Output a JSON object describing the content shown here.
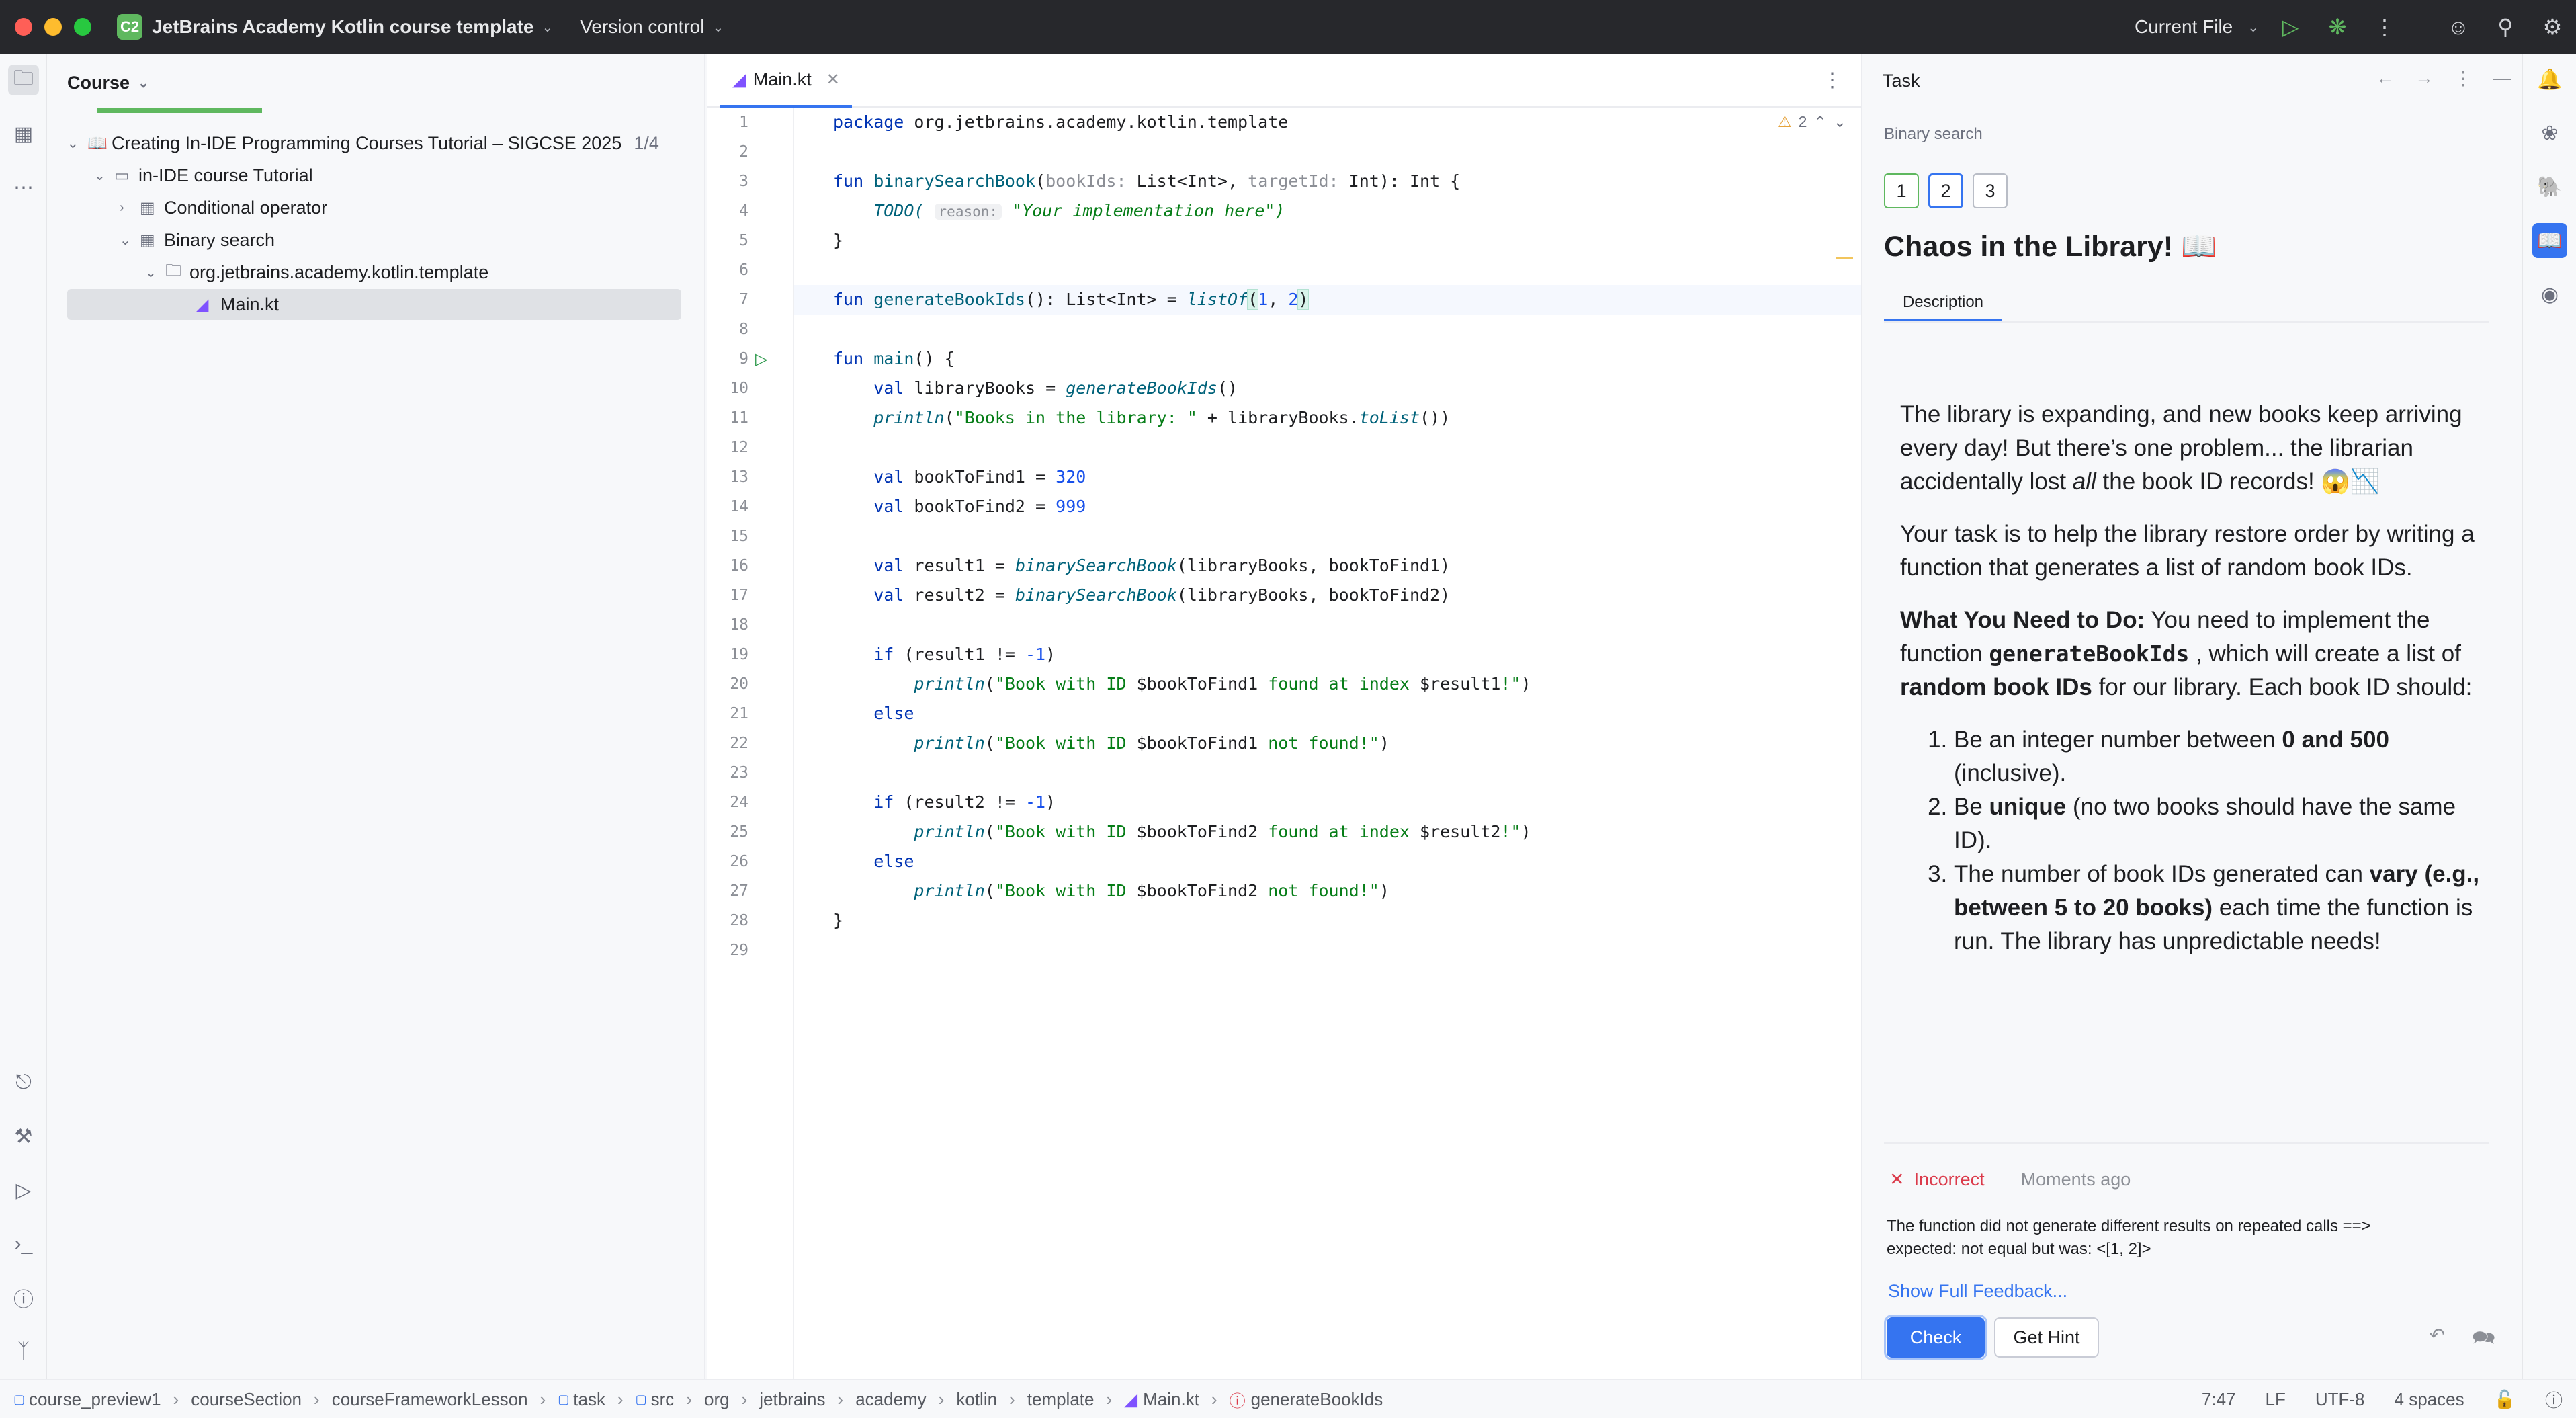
{
  "titlebar": {
    "project_badge": "C2",
    "project_name": "JetBrains Academy Kotlin course template",
    "vcs": "Version control",
    "run_config": "Current File",
    "colors": {
      "close": "#ff5f57",
      "minimize": "#febc2e",
      "zoom": "#28c840"
    }
  },
  "project_panel": {
    "header": "Course",
    "tree": [
      {
        "label": "Creating In-IDE Programming Courses Tutorial – SIGCSE 2025",
        "extra": "1/4"
      },
      {
        "label": "in-IDE course Tutorial"
      },
      {
        "label": "Conditional operator"
      },
      {
        "label": "Binary search"
      },
      {
        "label": "org.jetbrains.academy.kotlin.template"
      },
      {
        "label": "Main.kt"
      }
    ]
  },
  "editor": {
    "tab_label": "Main.kt",
    "warning_count": "2",
    "line_numbers": [
      "1",
      "2",
      "3",
      "4",
      "5",
      "6",
      "7",
      "8",
      "9",
      "10",
      "11",
      "12",
      "13",
      "14",
      "15",
      "16",
      "17",
      "18",
      "19",
      "20",
      "21",
      "22",
      "23",
      "24",
      "25",
      "26",
      "27",
      "28",
      "29"
    ],
    "hints": {
      "bookIds": "bookIds:",
      "targetId": "targetId:",
      "reason": "reason:"
    },
    "lines": {
      "l1_kw": "package",
      "l1_rest": " org.jetbrains.academy.kotlin.template",
      "l3_kw": "fun",
      "l3_fn": " binarySearchBook",
      "l3_a": "(",
      "l3_b": " List<Int>, ",
      "l3_c": " Int): Int {",
      "l4_todo": "    TODO(",
      "l4_str": " \"Your implementation here\")",
      "l5": "}",
      "l7_kw": "fun",
      "l7_fn": " generateBookIds",
      "l7_a": "(): List<Int> = ",
      "l7_call": "listOf",
      "l7_open": "(",
      "l7_n1": "1",
      "l7_comma": ", ",
      "l7_n2": "2",
      "l7_close": ")",
      "l9_kw": "fun",
      "l9_fn": " main",
      "l9_rest": "() {",
      "l10_kw": "    val",
      "l10_a": " libraryBooks = ",
      "l10_call": "generateBookIds",
      "l10_b": "()",
      "l11_call": "    println",
      "l11_a": "(",
      "l11_str": "\"Books in the library: \"",
      "l11_b": " + libraryBooks.",
      "l11_call2": "toList",
      "l11_c": "())",
      "l13_kw": "    val",
      "l13_a": " bookToFind1 = ",
      "l13_num": "320",
      "l14_kw": "    val",
      "l14_a": " bookToFind2 = ",
      "l14_num": "999",
      "l16_kw": "    val",
      "l16_a": " result1 = ",
      "l16_call": "binarySearchBook",
      "l16_b": "(libraryBooks, bookToFind1)",
      "l17_kw": "    val",
      "l17_a": " result2 = ",
      "l17_call": "binarySearchBook",
      "l17_b": "(libraryBooks, bookToFind2)",
      "l19_kw": "    if",
      "l19_a": " (result1 != ",
      "l19_num": "-1",
      "l19_b": ")",
      "l20_call": "        println",
      "l20_a": "(",
      "l20_s1": "\"Book with ID ",
      "l20_v1": "$bookToFind1",
      "l20_s2": " found at index ",
      "l20_v2": "$result1",
      "l20_s3": "!\"",
      "l20_b": ")",
      "l21_kw": "    else",
      "l22_call": "        println",
      "l22_a": "(",
      "l22_s1": "\"Book with ID ",
      "l22_v1": "$bookToFind1",
      "l22_s2": " not found!\"",
      "l22_b": ")",
      "l24_kw": "    if",
      "l24_a": " (result2 != ",
      "l24_num": "-1",
      "l24_b": ")",
      "l25_call": "        println",
      "l25_a": "(",
      "l25_s1": "\"Book with ID ",
      "l25_v1": "$bookToFind2",
      "l25_s2": " found at index ",
      "l25_v2": "$result2",
      "l25_s3": "!\"",
      "l25_b": ")",
      "l26_kw": "    else",
      "l27_call": "        println",
      "l27_a": "(",
      "l27_s1": "\"Book with ID ",
      "l27_v1": "$bookToFind2",
      "l27_s2": " not found!\"",
      "l27_b": ")",
      "l28": "}"
    }
  },
  "task_panel": {
    "header": "Task",
    "lesson": "Binary search",
    "steps": [
      "1",
      "2",
      "3"
    ],
    "title": "Chaos in the Library! 📖",
    "tab": "Description",
    "p1_a": "The library is expanding, and new books keep arriving every day! But there’s one problem... the librarian accidentally lost ",
    "p1_em": "all",
    "p1_b": " the book ID records! 😱📉",
    "p2": "Your task is to help the library restore order by writing a function that generates a list of random book IDs.",
    "p3_b1": "What You Need to Do:",
    "p3_a": " You need to implement the function ",
    "p3_code": "generateBookIds",
    "p3_c": " , which will create a list of ",
    "p3_b2": "random book IDs",
    "p3_d": " for our library. Each book ID should:",
    "li1_a": "Be an integer number between ",
    "li1_b": "0 and 500",
    "li1_c": " (inclusive).",
    "li2_a": "Be ",
    "li2_b": "unique",
    "li2_c": " (no two books should have the same ID).",
    "li3_a": "The number of book IDs generated can ",
    "li3_b": "vary (e.g., between 5 to 20 books)",
    "li3_c": " each time the function is run. The library has unpredictable needs!",
    "feedback": {
      "status": "Incorrect",
      "time": "Moments ago",
      "message_1": "The function did not generate different results on repeated calls ==>",
      "message_2": "expected: not equal but was: <[1, 2]>",
      "link": "Show Full Feedback...",
      "check": "Check",
      "hint": "Get Hint"
    }
  },
  "statusbar": {
    "crumbs": [
      "course_preview1",
      "courseSection",
      "courseFrameworkLesson",
      "task",
      "src",
      "org",
      "jetbrains",
      "academy",
      "kotlin",
      "template",
      "Main.kt",
      "generateBookIds"
    ],
    "position": "7:47",
    "line_sep": "LF",
    "encoding": "UTF-8",
    "indent": "4 spaces"
  }
}
